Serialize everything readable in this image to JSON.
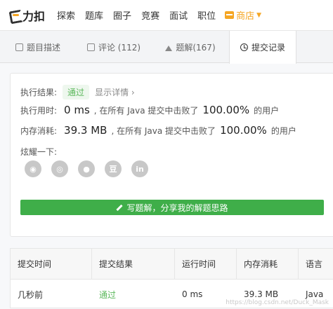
{
  "topbar": {
    "logo_text": "力扣",
    "nav": [
      "探索",
      "题库",
      "圈子",
      "竞赛",
      "面试",
      "职位"
    ],
    "store_label": "商店"
  },
  "tabs": [
    {
      "label": "题目描述",
      "icon": "document-icon"
    },
    {
      "label": "评论 (112)",
      "icon": "comment-icon"
    },
    {
      "label": "题解(167)",
      "icon": "flask-icon"
    },
    {
      "label": "提交记录",
      "icon": "clock-icon"
    }
  ],
  "result": {
    "status_label": "执行结果:",
    "status_value": "通过",
    "detail_link": "显示详情",
    "time_label": "执行用时:",
    "time_value": "0 ms",
    "time_mid": ", 在所有 Java 提交中击败了",
    "time_pct": "100.00%",
    "time_suffix": "的用户",
    "mem_label": "内存消耗:",
    "mem_value": "39.3 MB",
    "mem_mid": ", 在所有 Java 提交中击败了",
    "mem_pct": "100.00%",
    "mem_suffix": "的用户",
    "share_label": "炫耀一下:",
    "write_button": "写题解，分享我的解题思路"
  },
  "table": {
    "headers": [
      "提交时间",
      "提交结果",
      "运行时间",
      "内存消耗",
      "语言"
    ],
    "rows": [
      [
        "几秒前",
        "通过",
        "0 ms",
        "39.3 MB",
        "Java"
      ]
    ]
  },
  "watermark": "https://blog.csdn.net/Duck_Mask",
  "colors": {
    "accent": "#3fae49",
    "store": "#f5a623",
    "pass": "#5cb85c"
  }
}
